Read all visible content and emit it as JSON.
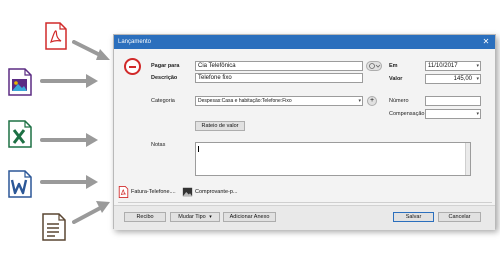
{
  "window": {
    "title": "Lançamento",
    "close_symbol": "✕"
  },
  "form": {
    "pagar_para": {
      "label": "Pagar para",
      "value": "Cia Telefônica"
    },
    "descricao": {
      "label": "Descrição",
      "value": "Telefone fixo"
    },
    "categoria": {
      "label": "Categoria",
      "value": "Despesas:Casa e habitação:Telefone:Fixo"
    },
    "em": {
      "label": "Em",
      "value": "11/10/2017"
    },
    "valor": {
      "label": "Valor",
      "value": "145,00"
    },
    "numero": {
      "label": "Número",
      "value": ""
    },
    "compensacao": {
      "label": "Compensação",
      "value": ""
    },
    "rateio_button": "Rateio de valor",
    "notas": {
      "label": "Notas",
      "value": ""
    },
    "add_category_symbol": "+"
  },
  "attachments": [
    {
      "name": "Fatura-Telefone....",
      "icon": "pdf-icon"
    },
    {
      "name": "Comprovante-p...",
      "icon": "image-icon"
    }
  ],
  "footer": {
    "recibo": "Recibo",
    "mudar_tipo": "Mudar Tipo",
    "adicionar_anexo": "Adicionar Anexo",
    "salvar": "Salvar",
    "cancelar": "Cancelar"
  },
  "file_types": [
    "pdf-icon",
    "image-icon",
    "excel-icon",
    "word-icon",
    "text-document-icon"
  ],
  "colors": {
    "accent": "#2b6fbd",
    "expense_red": "#d12a2a",
    "arrow_gray": "#9a9a9a",
    "pdf_red": "#d12a2a",
    "excel_green": "#1d7044",
    "word_blue": "#2b5797"
  }
}
